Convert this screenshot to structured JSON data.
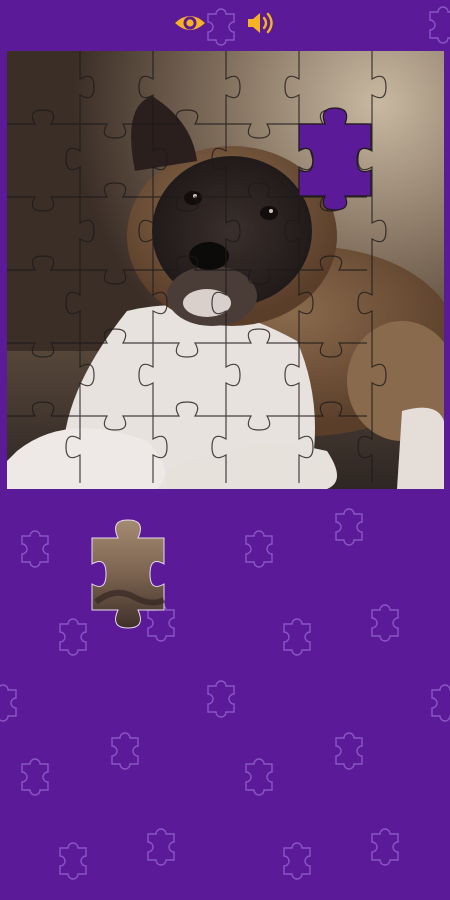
{
  "game": {
    "type": "jigsaw-puzzle",
    "grid": {
      "columns": 6,
      "rows": 6
    },
    "missing_piece": {
      "column": 5,
      "row": 2
    },
    "puzzle_image": "akita-puppy-photo"
  },
  "toolbar": {
    "preview_icon": "eye-icon",
    "sound_icon": "speaker-icon"
  },
  "colors": {
    "background": "#5b1a98",
    "accent": "#f5b324",
    "pattern": "#8a56c4"
  }
}
